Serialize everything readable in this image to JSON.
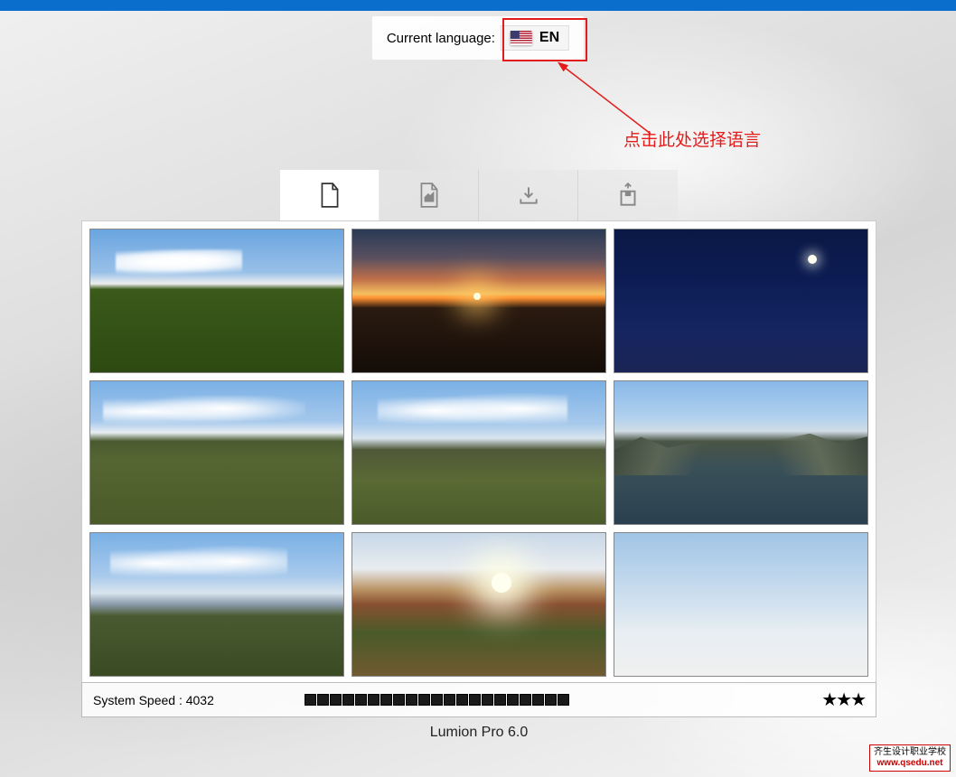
{
  "language": {
    "label": "Current language:",
    "code": "EN"
  },
  "annotation": {
    "text": "点击此处选择语言"
  },
  "tabs": [
    {
      "icon": "new-file",
      "active": true
    },
    {
      "icon": "open-file",
      "active": false
    },
    {
      "icon": "load",
      "active": false
    },
    {
      "icon": "save",
      "active": false
    }
  ],
  "scenes": [
    {
      "name": "grass-day"
    },
    {
      "name": "sunset-plain"
    },
    {
      "name": "night-moon"
    },
    {
      "name": "hills-grass"
    },
    {
      "name": "plain-mountains"
    },
    {
      "name": "lake-mountains"
    },
    {
      "name": "coast-grass"
    },
    {
      "name": "canyon-sun"
    },
    {
      "name": "white-empty"
    }
  ],
  "footer": {
    "speed_label": "System Speed : 4032",
    "speed_bars": 21,
    "stars": "★★★",
    "app_title": "Lumion Pro 6.0"
  },
  "watermark": {
    "line1": "齐生设计职业学校",
    "line2": "www.qsedu.net"
  }
}
